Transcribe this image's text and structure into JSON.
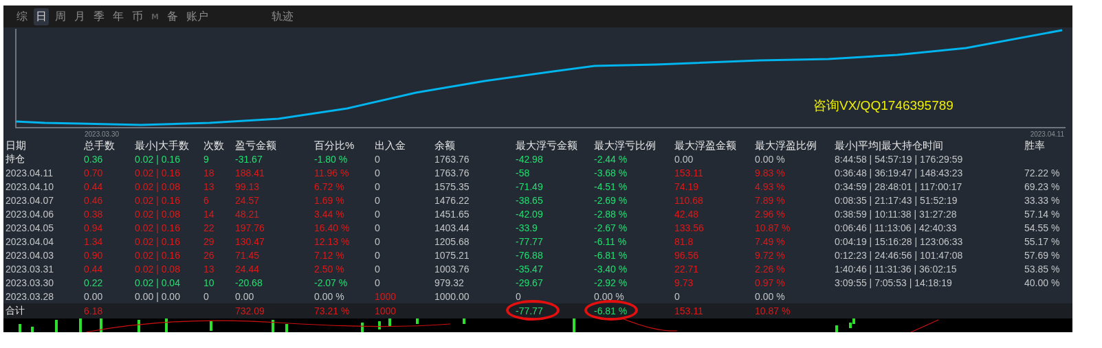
{
  "tabs": [
    {
      "label": "综",
      "selected": false,
      "disabled": false
    },
    {
      "label": "日",
      "selected": true,
      "disabled": false
    },
    {
      "label": "周",
      "selected": false,
      "disabled": false
    },
    {
      "label": "月",
      "selected": false,
      "disabled": false
    },
    {
      "label": "季",
      "selected": false,
      "disabled": false
    },
    {
      "label": "年",
      "selected": false,
      "disabled": false
    },
    {
      "label": "币",
      "selected": false,
      "disabled": false
    },
    {
      "label": "M",
      "selected": false,
      "disabled": true
    },
    {
      "label": "备",
      "selected": false,
      "disabled": false
    },
    {
      "label": "账户",
      "selected": false,
      "disabled": false
    }
  ],
  "track_tab": {
    "label": "轨迹"
  },
  "chart": {
    "start_label": "2023.03.30",
    "end_label": "2023.04.11",
    "note": "咨询VX/QQ1746395789"
  },
  "table": {
    "columns": [
      "日期",
      "总手数",
      "最小|大手数",
      "次数",
      "盈亏金额",
      "百分比%",
      "出入金",
      "余额",
      "最大浮亏金额",
      "最大浮亏比例",
      "最大浮盈金额",
      "最大浮盈比例",
      "最小|平均|最大持仓时间",
      "胜率"
    ],
    "rows": [
      {
        "cells": [
          {
            "t": "持仓",
            "color": "#e6e6e6"
          },
          {
            "t": "0.36",
            "color": "#20e070"
          },
          {
            "t": "0.02 | 0.16",
            "color": "#20e070"
          },
          {
            "t": "9",
            "color": "#20e070"
          },
          {
            "t": "-31.67",
            "color": "#20e070"
          },
          {
            "t": "-1.80 %",
            "color": "#20e070"
          },
          {
            "t": "0",
            "color": "#c4c6c8"
          },
          {
            "t": "1763.76",
            "color": "#c4c6c8"
          },
          {
            "t": "-42.98",
            "color": "#20e070"
          },
          {
            "t": "-2.44 %",
            "color": "#20e070"
          },
          {
            "t": "0.00",
            "color": "#c4c6c8"
          },
          {
            "t": "0.00 %",
            "color": "#c4c6c8"
          },
          {
            "t": "8:44:58 | 54:57:19 | 176:29:59",
            "color": "#c4c6c8"
          }
        ]
      },
      {
        "cells": [
          {
            "t": "2023.04.11",
            "color": "#c4c6c8"
          },
          {
            "t": "0.70",
            "color": "#e01818"
          },
          {
            "t": "0.02 | 0.16",
            "color": "#e01818"
          },
          {
            "t": "18",
            "color": "#e01818"
          },
          {
            "t": "188.41",
            "color": "#e01818"
          },
          {
            "t": "11.96 %",
            "color": "#e01818"
          },
          {
            "t": "0",
            "color": "#c4c6c8"
          },
          {
            "t": "1763.76",
            "color": "#c4c6c8"
          },
          {
            "t": "-58",
            "color": "#20e070"
          },
          {
            "t": "-3.68 %",
            "color": "#20e070"
          },
          {
            "t": "153.11",
            "color": "#e01818"
          },
          {
            "t": "9.83 %",
            "color": "#e01818"
          },
          {
            "t": "0:36:48 | 36:19:47 | 148:43:23",
            "color": "#c4c6c8"
          },
          {
            "t": "72.22 %",
            "color": "#c4c6c8"
          }
        ]
      },
      {
        "cells": [
          {
            "t": "2023.04.10",
            "color": "#c4c6c8"
          },
          {
            "t": "0.44",
            "color": "#e01818"
          },
          {
            "t": "0.02 | 0.08",
            "color": "#e01818"
          },
          {
            "t": "13",
            "color": "#e01818"
          },
          {
            "t": "99.13",
            "color": "#e01818"
          },
          {
            "t": "6.72 %",
            "color": "#e01818"
          },
          {
            "t": "0",
            "color": "#c4c6c8"
          },
          {
            "t": "1575.35",
            "color": "#c4c6c8"
          },
          {
            "t": "-71.49",
            "color": "#20e070"
          },
          {
            "t": "-4.51 %",
            "color": "#20e070"
          },
          {
            "t": "74.19",
            "color": "#e01818"
          },
          {
            "t": "4.93 %",
            "color": "#e01818"
          },
          {
            "t": "0:34:59 | 28:48:01 | 117:00:17",
            "color": "#c4c6c8"
          },
          {
            "t": "69.23 %",
            "color": "#c4c6c8"
          }
        ]
      },
      {
        "cells": [
          {
            "t": "2023.04.07",
            "color": "#c4c6c8"
          },
          {
            "t": "0.46",
            "color": "#e01818"
          },
          {
            "t": "0.02 | 0.16",
            "color": "#e01818"
          },
          {
            "t": "6",
            "color": "#e01818"
          },
          {
            "t": "24.57",
            "color": "#e01818"
          },
          {
            "t": "1.69 %",
            "color": "#e01818"
          },
          {
            "t": "0",
            "color": "#c4c6c8"
          },
          {
            "t": "1476.22",
            "color": "#c4c6c8"
          },
          {
            "t": "-38.65",
            "color": "#20e070"
          },
          {
            "t": "-2.69 %",
            "color": "#20e070"
          },
          {
            "t": "110.68",
            "color": "#e01818"
          },
          {
            "t": "7.89 %",
            "color": "#e01818"
          },
          {
            "t": "0:08:35 | 21:17:43 | 51:52:19",
            "color": "#c4c6c8"
          },
          {
            "t": "33.33 %",
            "color": "#c4c6c8"
          }
        ]
      },
      {
        "cells": [
          {
            "t": "2023.04.06",
            "color": "#c4c6c8"
          },
          {
            "t": "0.38",
            "color": "#e01818"
          },
          {
            "t": "0.02 | 0.08",
            "color": "#e01818"
          },
          {
            "t": "14",
            "color": "#e01818"
          },
          {
            "t": "48.21",
            "color": "#e01818"
          },
          {
            "t": "3.44 %",
            "color": "#e01818"
          },
          {
            "t": "0",
            "color": "#c4c6c8"
          },
          {
            "t": "1451.65",
            "color": "#c4c6c8"
          },
          {
            "t": "-42.09",
            "color": "#20e070"
          },
          {
            "t": "-2.88 %",
            "color": "#20e070"
          },
          {
            "t": "42.48",
            "color": "#e01818"
          },
          {
            "t": "2.96 %",
            "color": "#e01818"
          },
          {
            "t": "0:38:59 | 10:11:38 | 31:27:28",
            "color": "#c4c6c8"
          },
          {
            "t": "57.14 %",
            "color": "#c4c6c8"
          }
        ]
      },
      {
        "cells": [
          {
            "t": "2023.04.05",
            "color": "#c4c6c8"
          },
          {
            "t": "0.94",
            "color": "#e01818"
          },
          {
            "t": "0.02 | 0.16",
            "color": "#e01818"
          },
          {
            "t": "22",
            "color": "#e01818"
          },
          {
            "t": "197.76",
            "color": "#e01818"
          },
          {
            "t": "16.40 %",
            "color": "#e01818"
          },
          {
            "t": "0",
            "color": "#c4c6c8"
          },
          {
            "t": "1403.44",
            "color": "#c4c6c8"
          },
          {
            "t": "-33.9",
            "color": "#20e070"
          },
          {
            "t": "-2.67 %",
            "color": "#20e070"
          },
          {
            "t": "133.56",
            "color": "#e01818"
          },
          {
            "t": "10.87 %",
            "color": "#e01818"
          },
          {
            "t": "0:06:46 | 11:13:06 | 42:40:33",
            "color": "#c4c6c8"
          },
          {
            "t": "54.55 %",
            "color": "#c4c6c8"
          }
        ]
      },
      {
        "cells": [
          {
            "t": "2023.04.04",
            "color": "#c4c6c8"
          },
          {
            "t": "1.34",
            "color": "#e01818"
          },
          {
            "t": "0.02 | 0.16",
            "color": "#e01818"
          },
          {
            "t": "29",
            "color": "#e01818"
          },
          {
            "t": "130.47",
            "color": "#e01818"
          },
          {
            "t": "12.13 %",
            "color": "#e01818"
          },
          {
            "t": "0",
            "color": "#c4c6c8"
          },
          {
            "t": "1205.68",
            "color": "#c4c6c8"
          },
          {
            "t": "-77.77",
            "color": "#20e070"
          },
          {
            "t": "-6.11 %",
            "color": "#20e070"
          },
          {
            "t": "81.8",
            "color": "#e01818"
          },
          {
            "t": "7.49 %",
            "color": "#e01818"
          },
          {
            "t": "0:04:19 | 15:16:28 | 123:06:33",
            "color": "#c4c6c8"
          },
          {
            "t": "55.17 %",
            "color": "#c4c6c8"
          }
        ]
      },
      {
        "cells": [
          {
            "t": "2023.04.03",
            "color": "#c4c6c8"
          },
          {
            "t": "0.90",
            "color": "#e01818"
          },
          {
            "t": "0.02 | 0.16",
            "color": "#e01818"
          },
          {
            "t": "26",
            "color": "#e01818"
          },
          {
            "t": "71.45",
            "color": "#e01818"
          },
          {
            "t": "7.12 %",
            "color": "#e01818"
          },
          {
            "t": "0",
            "color": "#c4c6c8"
          },
          {
            "t": "1075.21",
            "color": "#c4c6c8"
          },
          {
            "t": "-76.88",
            "color": "#20e070"
          },
          {
            "t": "-6.81 %",
            "color": "#20e070"
          },
          {
            "t": "96.56",
            "color": "#e01818"
          },
          {
            "t": "9.72 %",
            "color": "#e01818"
          },
          {
            "t": "0:12:23 | 24:46:56 | 101:47:08",
            "color": "#c4c6c8"
          },
          {
            "t": "57.69 %",
            "color": "#c4c6c8"
          }
        ]
      },
      {
        "cells": [
          {
            "t": "2023.03.31",
            "color": "#c4c6c8"
          },
          {
            "t": "0.44",
            "color": "#e01818"
          },
          {
            "t": "0.02 | 0.08",
            "color": "#e01818"
          },
          {
            "t": "13",
            "color": "#e01818"
          },
          {
            "t": "24.44",
            "color": "#e01818"
          },
          {
            "t": "2.50 %",
            "color": "#e01818"
          },
          {
            "t": "0",
            "color": "#c4c6c8"
          },
          {
            "t": "1003.76",
            "color": "#c4c6c8"
          },
          {
            "t": "-35.47",
            "color": "#20e070"
          },
          {
            "t": "-3.40 %",
            "color": "#20e070"
          },
          {
            "t": "22.71",
            "color": "#e01818"
          },
          {
            "t": "2.26 %",
            "color": "#e01818"
          },
          {
            "t": "1:40:46 | 11:31:36 | 36:02:15",
            "color": "#c4c6c8"
          },
          {
            "t": "53.85 %",
            "color": "#c4c6c8"
          }
        ]
      },
      {
        "cells": [
          {
            "t": "2023.03.30",
            "color": "#c4c6c8"
          },
          {
            "t": "0.22",
            "color": "#20e070"
          },
          {
            "t": "0.02 | 0.04",
            "color": "#20e070"
          },
          {
            "t": "10",
            "color": "#20e070"
          },
          {
            "t": "-20.68",
            "color": "#20e070"
          },
          {
            "t": "-2.07 %",
            "color": "#20e070"
          },
          {
            "t": "0",
            "color": "#c4c6c8"
          },
          {
            "t": "979.32",
            "color": "#c4c6c8"
          },
          {
            "t": "-29.67",
            "color": "#20e070"
          },
          {
            "t": "-2.92 %",
            "color": "#20e070"
          },
          {
            "t": "9.73",
            "color": "#e01818"
          },
          {
            "t": "0.97 %",
            "color": "#e01818"
          },
          {
            "t": "3:09:55 | 7:05:53 | 14:18:19",
            "color": "#c4c6c8"
          },
          {
            "t": "40.00 %",
            "color": "#c4c6c8"
          }
        ]
      },
      {
        "cells": [
          {
            "t": "2023.03.28",
            "color": "#c4c6c8"
          },
          {
            "t": "0.00",
            "color": "#c4c6c8"
          },
          {
            "t": "0.00 | 0.00",
            "color": "#c4c6c8"
          },
          {
            "t": "0",
            "color": "#c4c6c8"
          },
          {
            "t": "0.00",
            "color": "#c4c6c8"
          },
          {
            "t": "0.00 %",
            "color": "#c4c6c8"
          },
          {
            "t": "1000",
            "color": "#e01818"
          },
          {
            "t": "1000.00",
            "color": "#c4c6c8"
          },
          {
            "t": "0",
            "color": "#c4c6c8"
          },
          {
            "t": "0.00 %",
            "color": "#c4c6c8"
          },
          {
            "t": "0",
            "color": "#c4c6c8"
          },
          {
            "t": "0.00 %",
            "color": "#c4c6c8"
          }
        ]
      }
    ],
    "total": {
      "cells": [
        {
          "t": "合计",
          "color": "#e6e6e6",
          "circled": false
        },
        {
          "t": "6.18",
          "color": "#e01818",
          "circled": false
        },
        null,
        null,
        {
          "t": "732.09",
          "color": "#e01818",
          "circled": false
        },
        {
          "t": "73.21 %",
          "color": "#e01818",
          "circled": false
        },
        {
          "t": "1000",
          "color": "#e01818",
          "circled": false
        },
        null,
        {
          "t": "-77.77",
          "color": "#20e070",
          "circled": true
        },
        {
          "t": "-6.81 %",
          "color": "#20e070",
          "circled": true
        },
        {
          "t": "153.11",
          "color": "#e01818",
          "circled": false
        },
        {
          "t": "10.87 %",
          "color": "#e01818",
          "circled": false
        }
      ]
    }
  }
}
